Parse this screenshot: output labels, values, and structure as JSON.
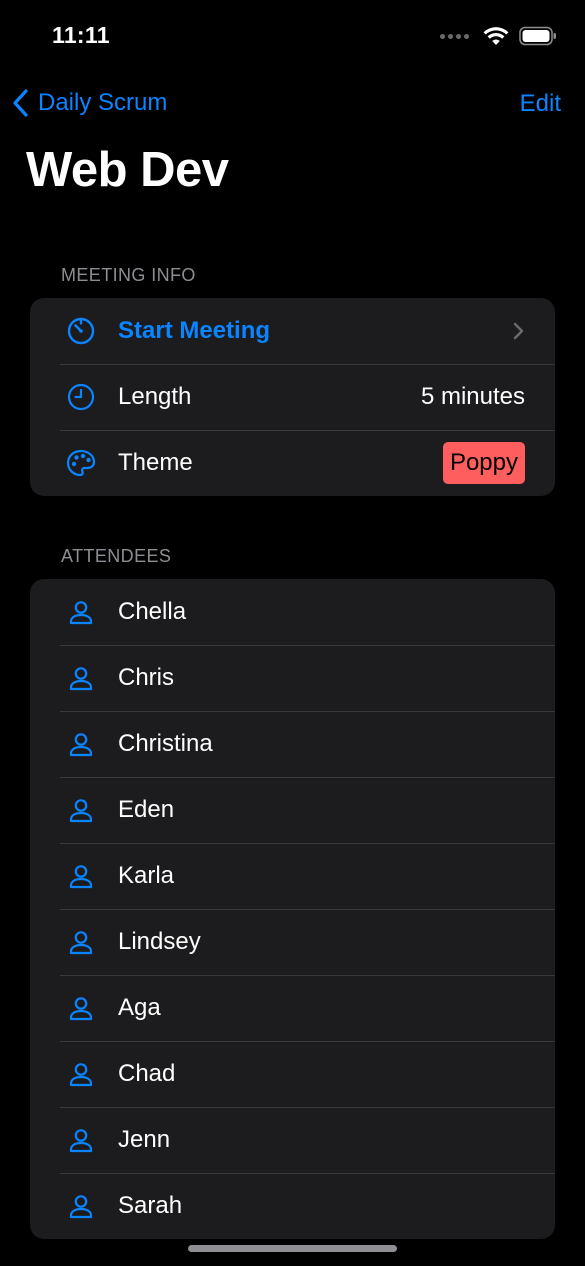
{
  "status_bar": {
    "time": "11:11"
  },
  "nav": {
    "back_label": "Daily Scrum",
    "edit_label": "Edit"
  },
  "title": "Web Dev",
  "meeting_info": {
    "header": "MEETING INFO",
    "start_label": "Start Meeting",
    "length_label": "Length",
    "length_value": "5 minutes",
    "theme_label": "Theme",
    "theme_value": "Poppy",
    "theme_color": "#ff5e5e"
  },
  "attendees": {
    "header": "ATTENDEES",
    "items": [
      {
        "name": "Chella"
      },
      {
        "name": "Chris"
      },
      {
        "name": "Christina"
      },
      {
        "name": "Eden"
      },
      {
        "name": "Karla"
      },
      {
        "name": "Lindsey"
      },
      {
        "name": "Aga"
      },
      {
        "name": "Chad"
      },
      {
        "name": "Jenn"
      },
      {
        "name": "Sarah"
      }
    ]
  },
  "colors": {
    "accent": "#0a84ff",
    "background": "#000000",
    "group_background": "#1c1c1e",
    "secondary_text": "#8d8d93"
  },
  "icons": {
    "back": "chevron-left-icon",
    "start": "timer-icon",
    "length": "clock-icon",
    "theme": "palette-icon",
    "attendee": "person-icon",
    "disclosure": "chevron-right-icon"
  }
}
